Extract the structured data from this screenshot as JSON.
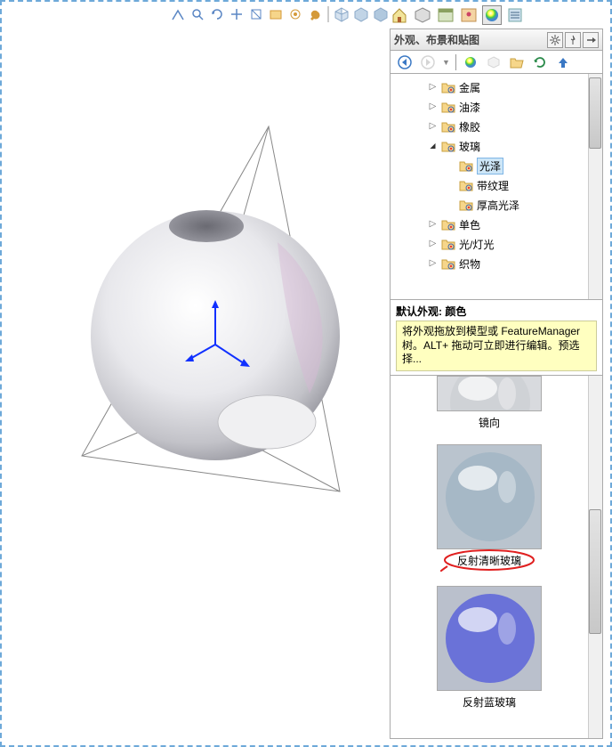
{
  "panel": {
    "title": "外观、布景和贴图",
    "header_icons": {
      "gear": "⚙",
      "pin": "📌",
      "out": "→"
    }
  },
  "nav": {
    "back": "left",
    "fwd": "right"
  },
  "tree": {
    "items": [
      {
        "level": 1,
        "expander": "▷",
        "label": "金属"
      },
      {
        "level": 1,
        "expander": "▷",
        "label": "油漆"
      },
      {
        "level": 1,
        "expander": "▷",
        "label": "橡胶"
      },
      {
        "level": 1,
        "expander": "⊿",
        "label": "玻璃"
      },
      {
        "level": 2,
        "expander": "",
        "label": "光泽",
        "selected": true
      },
      {
        "level": 2,
        "expander": "",
        "label": "带纹理"
      },
      {
        "level": 2,
        "expander": "",
        "label": "厚高光泽"
      },
      {
        "level": 1,
        "expander": "▷",
        "label": "单色"
      },
      {
        "level": 1,
        "expander": "▷",
        "label": "光/灯光"
      },
      {
        "level": 1,
        "expander": "▷",
        "label": "织物"
      }
    ]
  },
  "status": {
    "label": "默认外观: 颜色",
    "tip": "将外观拖放到模型或 FeatureManager 树。ALT+ 拖动可立即进行编辑。预选择..."
  },
  "gallery": {
    "items": [
      {
        "caption": "镜向",
        "style": "mirror",
        "partial": true
      },
      {
        "caption": "反射清晰玻璃",
        "style": "clear-reflect",
        "highlighted": true
      },
      {
        "caption": "反射蓝玻璃",
        "style": "blue-reflect"
      }
    ]
  }
}
